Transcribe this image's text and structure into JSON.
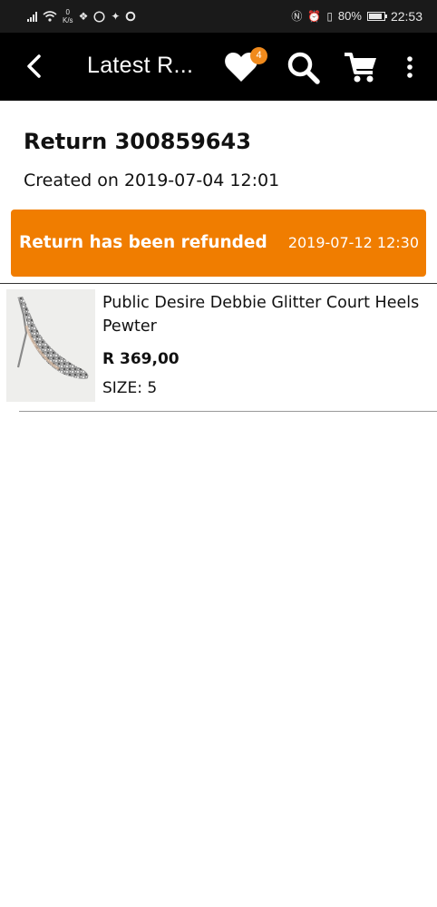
{
  "status_bar": {
    "speed_value": "0",
    "speed_unit": "K/s",
    "battery": "80%",
    "time": "22:53",
    "icons": [
      "signal-icon",
      "wifi-icon",
      "dropbox-icon",
      "whatsapp-icon",
      "twitter-icon",
      "circle-app-icon",
      "nfc-icon",
      "alarm-icon",
      "vibrate-icon",
      "battery-icon"
    ]
  },
  "app_bar": {
    "title": "Latest R...",
    "wishlist_count": "4",
    "icons": [
      "back-arrow-icon",
      "heart-icon",
      "search-icon",
      "cart-icon",
      "more-vert-icon"
    ]
  },
  "return": {
    "title": "Return 300859643",
    "created": "Created on 2019-07-04 12:01",
    "status": "Return has been refunded",
    "status_date": "2019-07-12 12:30",
    "status_color": "#f07d00"
  },
  "items": [
    {
      "name": "Public Desire Debbie Glitter Court Heels Pewter",
      "price": "R 369,00",
      "size": "SIZE: 5"
    }
  ]
}
